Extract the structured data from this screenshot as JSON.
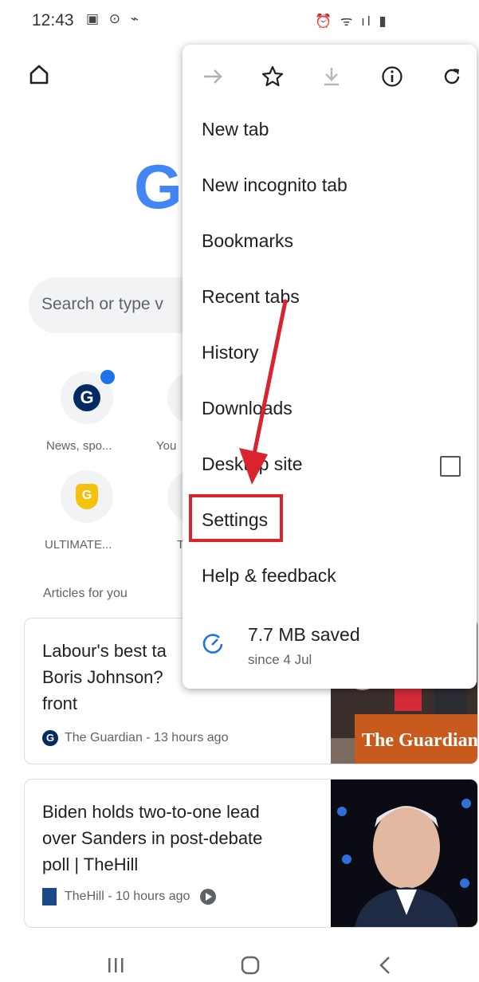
{
  "status_bar": {
    "time": "12:43",
    "left_icons": "▣ ⊙ ⌁",
    "right_icons": "⏰ ᯤ ıl ▮"
  },
  "background": {
    "google_logo_letter": "G",
    "search_placeholder": "Search or type v",
    "tiles": [
      {
        "label": "News, spo...",
        "icon": "guardian-logo"
      },
      {
        "label": "You",
        "icon": "partial-tile"
      },
      {
        "label": "ULTIMATE...",
        "icon": "shield-logo"
      },
      {
        "label": "T",
        "icon": "partial-tile"
      }
    ],
    "articles_label": "Articles for you",
    "articles": [
      {
        "title_lines": [
          "Labour's best ta",
          "Boris Johnson?",
          "front"
        ],
        "source": "The Guardian - 13 hours ago",
        "thumb_caption": "The Guardian"
      },
      {
        "title_lines": [
          "Biden holds two-to-one lead",
          "over Sanders in post-debate",
          "poll | TheHill"
        ],
        "source": "TheHill - 10 hours ago"
      }
    ]
  },
  "menu": {
    "toolbar_icons": [
      "forward-icon",
      "star-icon",
      "download-icon",
      "info-icon",
      "refresh-icon"
    ],
    "items": [
      {
        "label": "New tab"
      },
      {
        "label": "New incognito tab"
      },
      {
        "label": "Bookmarks"
      },
      {
        "label": "Recent tabs"
      },
      {
        "label": "History"
      },
      {
        "label": "Downloads"
      },
      {
        "label": "Desktop site"
      },
      {
        "label": "Settings"
      },
      {
        "label": "Help & feedback"
      }
    ],
    "data_saved": {
      "amount": "7.7 MB saved",
      "since": "since 4 Jul"
    }
  },
  "colors": {
    "highlight": "#d9232d",
    "arrow": "#d9232d",
    "google_blue": "#4285f4"
  },
  "nav_bar": {
    "icons": [
      "recents-icon",
      "home-button-icon",
      "back-icon"
    ]
  }
}
